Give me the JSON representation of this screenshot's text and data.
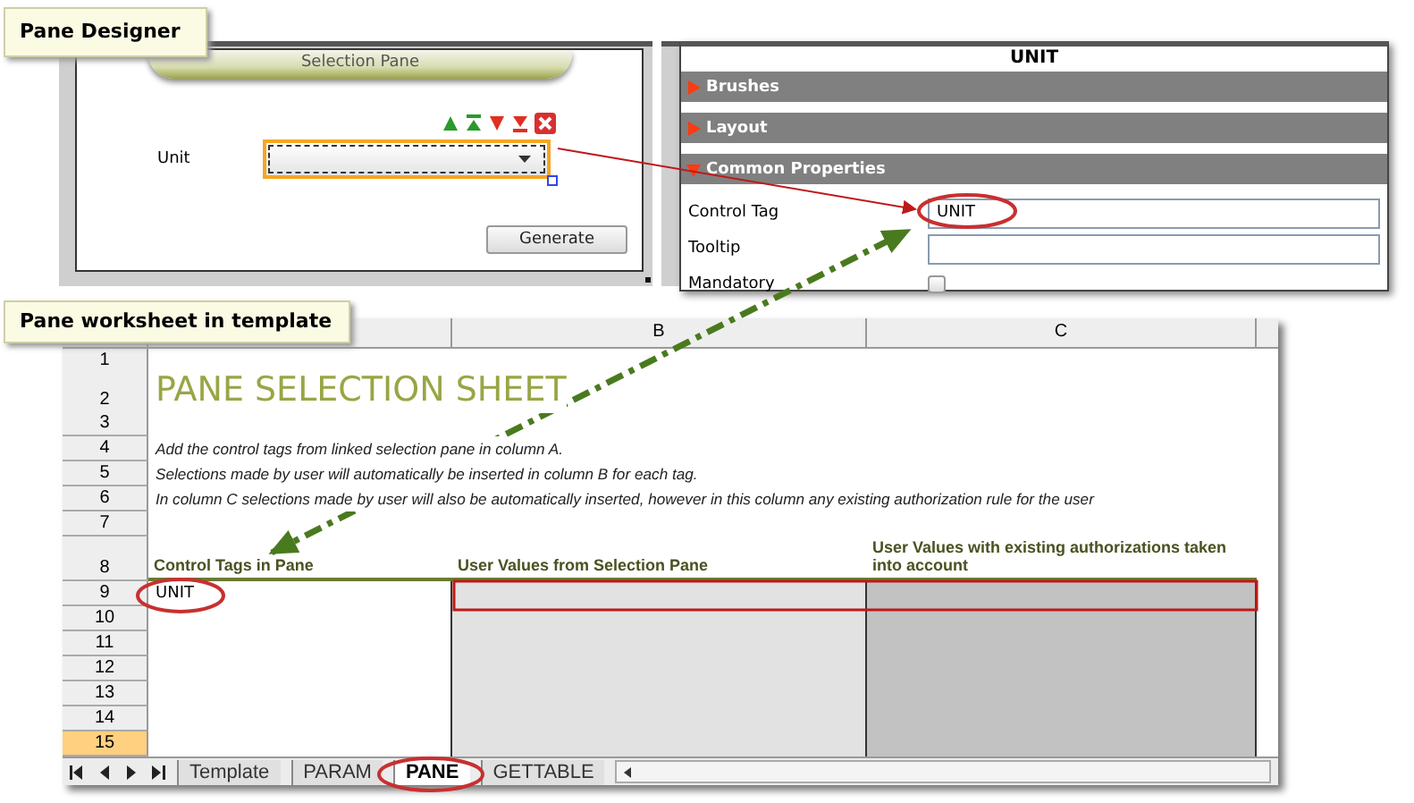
{
  "designer": {
    "callout": "Pane Designer",
    "pane_title": "Selection Pane",
    "field_label": "Unit",
    "button": "Generate"
  },
  "properties": {
    "title": "UNIT",
    "sections": [
      {
        "label": "Brushes",
        "expanded": false
      },
      {
        "label": "Layout",
        "expanded": false
      },
      {
        "label": "Common Properties",
        "expanded": true
      }
    ],
    "fields": [
      {
        "kind": "text",
        "label": "Control Tag",
        "value": "UNIT"
      },
      {
        "kind": "text",
        "label": "Tooltip"
      },
      {
        "kind": "checkbox",
        "label": "Mandatory",
        "checked": false
      }
    ]
  },
  "sheet": {
    "callout": "Pane worksheet in template",
    "columns": [
      "B",
      "C"
    ],
    "rows": [
      {
        "number": "1",
        "kind": "thin",
        "selected": false
      },
      {
        "number": "2",
        "kind": "title",
        "selected": false,
        "text": "PANE SELECTION SHEET"
      },
      {
        "number": "3",
        "kind": "blank",
        "selected": false
      },
      {
        "number": "4",
        "kind": "note",
        "selected": false,
        "text": "Add the control tags from linked selection pane in column A."
      },
      {
        "number": "5",
        "kind": "note",
        "selected": false,
        "text": "Selections made by user will automatically be inserted in column B for each tag."
      },
      {
        "number": "6",
        "kind": "note",
        "selected": false,
        "text": "In column C selections made by user will also be automatically inserted, however in this column any existing authorization rule for the user"
      },
      {
        "number": "7",
        "kind": "blank",
        "selected": false
      },
      {
        "number": "8",
        "kind": "header",
        "selected": false,
        "cells": [
          "Control Tags in Pane",
          "User Values from Selection Pane",
          "User Values with existing authorizations taken into account"
        ]
      },
      {
        "number": "9",
        "kind": "data",
        "selected": false,
        "cells": [
          "UNIT"
        ]
      },
      {
        "number": "10",
        "kind": "data",
        "selected": false
      },
      {
        "number": "11",
        "kind": "data",
        "selected": false
      },
      {
        "number": "12",
        "kind": "data",
        "selected": false
      },
      {
        "number": "13",
        "kind": "data",
        "selected": false
      },
      {
        "number": "14",
        "kind": "data",
        "selected": false
      },
      {
        "number": "15",
        "kind": "data",
        "selected": true
      }
    ],
    "tabs": [
      {
        "label": "Template",
        "selected": false
      },
      {
        "label": "PARAM",
        "selected": false
      },
      {
        "label": "PANE",
        "selected": true
      },
      {
        "label": "GETTABLE",
        "selected": false
      }
    ]
  }
}
